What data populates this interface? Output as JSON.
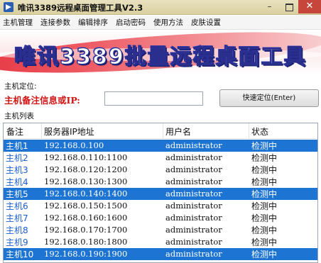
{
  "window": {
    "title": "唯讯3389远程桌面管理工具V2.3",
    "minimize": "–",
    "close": "✕"
  },
  "menu": [
    "主机管理",
    "连接参数",
    "编辑排序",
    "启动密码",
    "使用方法",
    "皮肤设置"
  ],
  "banner": {
    "text": "唯讯3389批量远程桌面工具"
  },
  "locate": {
    "section_label": "主机定位:",
    "field_label": "主机备注信息或IP:",
    "input_value": "",
    "button_label": "快速定位(Enter)"
  },
  "host_list": {
    "section_label": "主机列表",
    "columns": [
      "备注",
      "服务器IP地址",
      "用户名",
      "状态"
    ],
    "rows": [
      {
        "name": "主机1",
        "ip": "192.168.0.100",
        "user": "administrator",
        "status": "检测中",
        "selected": true
      },
      {
        "name": "主机2",
        "ip": "192.168.0.110:1100",
        "user": "administrator",
        "status": "检测中",
        "selected": false
      },
      {
        "name": "主机3",
        "ip": "192.168.0.120:1200",
        "user": "administrator",
        "status": "检测中",
        "selected": false
      },
      {
        "name": "主机4",
        "ip": "192.168.0.130:1300",
        "user": "administrator",
        "status": "检测中",
        "selected": false
      },
      {
        "name": "主机5",
        "ip": "192.168.0.140:1400",
        "user": "administrator",
        "status": "检测中",
        "selected": true
      },
      {
        "name": "主机6",
        "ip": "192.168.0.150:1500",
        "user": "administrator",
        "status": "检测中",
        "selected": false
      },
      {
        "name": "主机7",
        "ip": "192.168.0.160:1600",
        "user": "administrator",
        "status": "检测中",
        "selected": false
      },
      {
        "name": "主机8",
        "ip": "192.168.0.170:1700",
        "user": "administrator",
        "status": "检测中",
        "selected": false
      },
      {
        "name": "主机9",
        "ip": "192.168.0.180:1800",
        "user": "administrator",
        "status": "检测中",
        "selected": false
      },
      {
        "name": "主机10",
        "ip": "192.168.0.190:1900",
        "user": "administrator",
        "status": "检测中",
        "selected": true
      }
    ]
  }
}
